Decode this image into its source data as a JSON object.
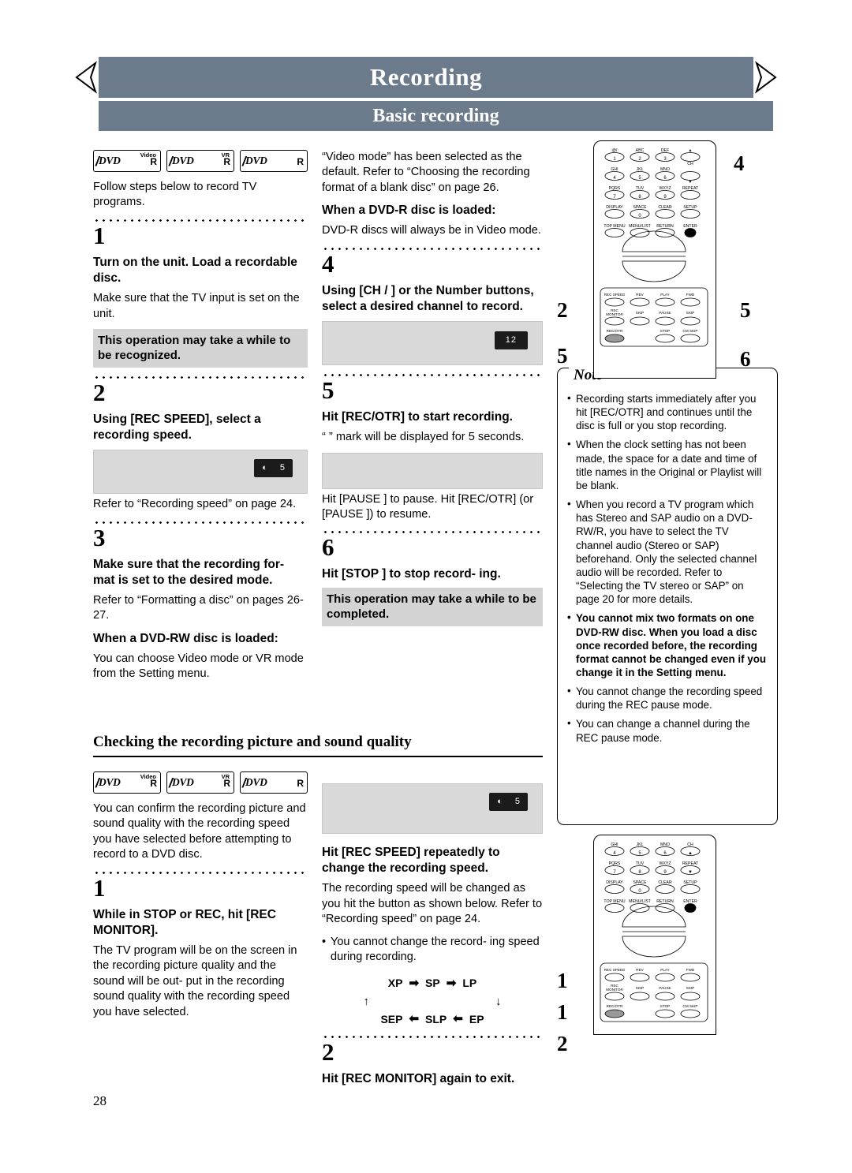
{
  "header": {
    "title": "Recording",
    "subtitle": "Basic recording",
    "band_color": "#6b7b8c"
  },
  "page_number": "28",
  "logos": [
    {
      "main": "DVD",
      "sup": "Video",
      "r": "R"
    },
    {
      "main": "DVD",
      "sup": "VR",
      "r": "R"
    },
    {
      "main": "DVD",
      "sup": "",
      "r": "R"
    }
  ],
  "column1": {
    "intro": "Follow steps below to record TV programs.",
    "steps": [
      {
        "num": "1",
        "heading": "Turn on the unit. Load a recordable disc.",
        "body": "Make sure that the TV input is set on the unit.",
        "highlight": "This operation may take a while to be recognized."
      },
      {
        "num": "2",
        "heading": "Using [REC SPEED], select a recording speed.",
        "screen_badge": "5",
        "body": "Refer to “Recording speed” on page 24."
      },
      {
        "num": "3",
        "heading": "Make sure that the recording for- mat is set to the desired mode.",
        "body": "Refer to “Formatting a disc” on pages 26-27.",
        "subheading": "When a DVD-RW disc is loaded:",
        "body2": "You can choose Video mode or VR mode from the Setting menu."
      }
    ]
  },
  "column2": {
    "intro": "“Video mode” has been selected as the default. Refer to “Choosing the recording format of a blank disc” on page 26.",
    "dvdr_heading": "When a DVD-R disc is loaded:",
    "dvdr_body": "DVD-R discs will always be in Video mode.",
    "steps": [
      {
        "num": "4",
        "heading": "Using [CH  / ] or the Number buttons, select a desired channel to record.",
        "screen_badge": "12"
      },
      {
        "num": "5",
        "heading": "Hit [REC/OTR] to start recording.",
        "body": "“ ” mark will be displayed for 5 seconds.",
        "body2": "Hit [PAUSE  ] to pause. Hit [REC/OTR] (or [PAUSE  ]) to resume.",
        "pause_label_1": "PAUSE",
        "pause_label_2": "REC/OTR",
        "pause_label_3": "PAUSE"
      },
      {
        "num": "6",
        "heading": "Hit [STOP  ] to stop record- ing.",
        "highlight": "This operation may take a while to be completed."
      }
    ]
  },
  "section2": {
    "title": "Checking the recording picture and sound quality",
    "intro": "You can confirm the recording picture and sound quality with the recording speed you have selected before attempting to record to a DVD disc.",
    "screen_badge": "5",
    "steps": [
      {
        "num": "1",
        "heading": "While in STOP or REC, hit [REC MONITOR].",
        "body": "The TV program will be on the screen in the recording picture quality and the sound will be out- put in the recording sound quality with the recording speed you have selected."
      },
      {
        "num": "2",
        "heading": "Hit [REC MONITOR] again to exit."
      }
    ],
    "right_steps": [
      {
        "heading": "Hit [REC SPEED] repeatedly to change the recording speed.",
        "body": "The recording speed will be changed as you hit the button as shown below. Refer to “Recording speed” on page 24.",
        "bullet": "You cannot change the record- ing speed during recording."
      }
    ],
    "speed_diagram": {
      "row1": [
        "XP",
        "SP",
        "LP"
      ],
      "row2": [
        "SEP",
        "SLP",
        "EP"
      ]
    }
  },
  "note": {
    "title": "Note",
    "items": [
      {
        "text": "Recording starts immediately after you hit [REC/OTR] and continues until the disc is full or you stop recording.",
        "bold": false
      },
      {
        "text": "When the clock setting has not been made, the space for a date and time of title names in the Original or Playlist will be blank.",
        "bold": false
      },
      {
        "text": "When you record a TV program which has Stereo and SAP audio on a DVD-RW/R, you have to select the TV channel audio (Stereo or SAP) beforehand. Only the selected channel audio will be recorded. Refer to “Selecting the TV stereo or SAP” on page 20 for more details.",
        "bold": false
      },
      {
        "text": "You cannot mix two formats on one DVD-RW disc. When you load a disc once recorded before, the recording format cannot be changed even if you change it in the Setting menu.",
        "bold": true
      },
      {
        "text": "You cannot change the recording speed during the REC pause mode.",
        "bold": false
      },
      {
        "text": "You can change a channel during the REC pause mode.",
        "bold": false
      }
    ]
  },
  "remote_top": {
    "callouts": [
      "4",
      "2",
      "5",
      "5",
      "6"
    ],
    "keypad_rows": [
      [
        ":@/:",
        "ABC",
        "DEF",
        "▲"
      ],
      [
        "1",
        "2",
        "3",
        "CH"
      ],
      [
        "GHI",
        "JKL",
        "MNO",
        "▼"
      ],
      [
        "4",
        "5",
        "6",
        ""
      ],
      [
        "PQRS",
        "TUV",
        "WXYZ",
        "REPEAT"
      ],
      [
        "7",
        "8",
        "9",
        ""
      ],
      [
        "DISPLAY",
        "SPACE",
        "CLEAR",
        "SETUP"
      ],
      [
        "",
        "0",
        "",
        ""
      ],
      [
        "TOP MENU",
        "MENU/LIST",
        "RETURN",
        "ENTER"
      ]
    ],
    "transport_rows": [
      [
        "REC SPEED",
        "REV",
        "PLAY",
        "FWD"
      ],
      [
        "REC MONITOR",
        "SKIP",
        "PAUSE",
        "SKIP"
      ],
      [
        "REC/OTR",
        "",
        "STOP",
        "CM SKIP"
      ]
    ]
  },
  "remote_bottom": {
    "callouts": [
      "1",
      "1",
      "2"
    ],
    "keypad_rows": [
      [
        "GHI",
        "JKL",
        "MNO",
        "CH"
      ],
      [
        "4",
        "5",
        "6",
        "▲"
      ],
      [
        "PQRS",
        "TUV",
        "WXYZ",
        "REPEAT"
      ],
      [
        "7",
        "8",
        "9",
        "▼"
      ],
      [
        "DISPLAY",
        "SPACE",
        "CLEAR",
        "SETUP"
      ],
      [
        "",
        "0",
        "",
        ""
      ],
      [
        "TOP MENU",
        "MENU/LIST",
        "RETURN",
        "ENTER"
      ]
    ],
    "transport_rows": [
      [
        "REC SPEED",
        "REV",
        "PLAY",
        "FWD"
      ],
      [
        "REC MONITOR",
        "SKIP",
        "PAUSE",
        "SKIP"
      ],
      [
        "REC/OTR",
        "",
        "STOP",
        "CM SKIP"
      ]
    ]
  }
}
